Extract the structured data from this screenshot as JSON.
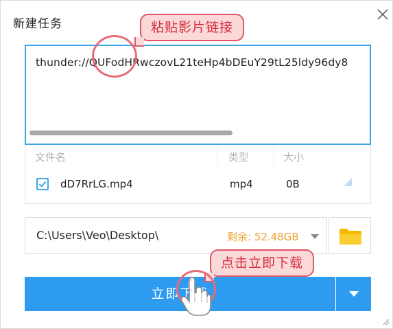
{
  "dialog": {
    "title": "新建任务"
  },
  "url_input": {
    "value": "thunder://QUFodHRwczovL21teHp4bDEuY29tL25ldy96dy8"
  },
  "file_table": {
    "headers": {
      "name": "文件名",
      "type": "类型",
      "size": "大小"
    },
    "rows": [
      {
        "name": "dD7RrLG.mp4",
        "type": "mp4",
        "size": "0B",
        "checked": true
      }
    ]
  },
  "save_path": {
    "value": "C:\\Users\\Veo\\Desktop\\",
    "free_space": "剩余: 52.48GB"
  },
  "download_button": {
    "label": "立即下载"
  },
  "annotations": {
    "paste_link": "粘贴影片链接",
    "click_download": "点击立即下载"
  },
  "colors": {
    "accent": "#2d9cf0",
    "input_border": "#3aa6e6",
    "free_space": "#f0a030",
    "folder": "#f5b800",
    "callout_fill": "#fbd9d9",
    "callout_border": "#e05566",
    "callout_text": "#d62a3b"
  },
  "icons": {
    "close": "close-icon",
    "check": "check-icon",
    "dropdown": "chevron-down-icon",
    "folder": "folder-icon",
    "hand": "hand-pointer-icon"
  }
}
